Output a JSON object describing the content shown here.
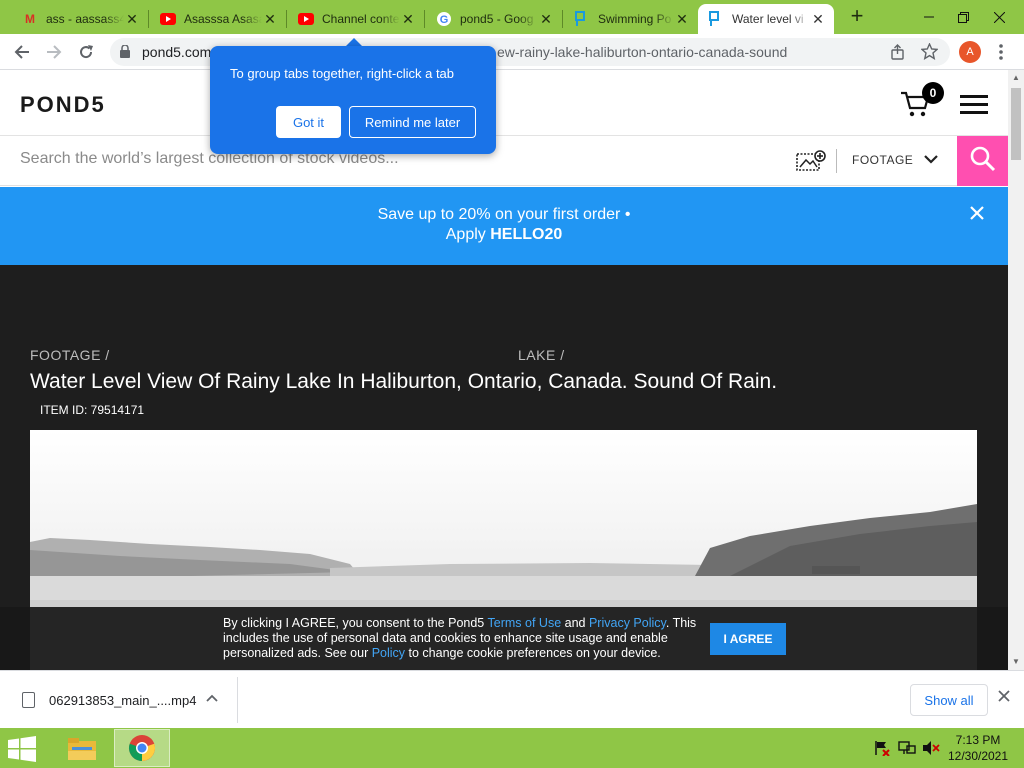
{
  "browser": {
    "tabs": [
      {
        "title": "ass - aassass4",
        "icon": "gmail-icon",
        "icon_color": "#d93025"
      },
      {
        "title": "Asasssa Asasa",
        "icon": "youtube-icon",
        "icon_color": "#ff0000"
      },
      {
        "title": "Channel conte",
        "icon": "youtube-icon",
        "icon_color": "#ff0000"
      },
      {
        "title": "pond5 - Goog",
        "icon": "google-icon",
        "icon_color": "#4285f4"
      },
      {
        "title": "Swimming Po",
        "icon": "pond5-icon",
        "icon_color": "#1a9ae0"
      },
      {
        "title": "Water level vi",
        "icon": "pond5-icon",
        "icon_color": "#1a9ae0"
      }
    ],
    "new_tab_label": "+",
    "url_host": "pond5.com",
    "url_rest": "ew-rainy-lake-haliburton-ontario-canada-sound",
    "profile_initial": "A"
  },
  "popup": {
    "text": "To group tabs together, right-click a tab",
    "got_it": "Got it",
    "remind": "Remind me later"
  },
  "site": {
    "logo": "POND5",
    "cart_count": "0",
    "search_placeholder": "Search the world’s largest collection of stock videos...",
    "filter_label": "FOOTAGE",
    "accent_color": "#ff4fb0"
  },
  "promo": {
    "line1": "Save up to 20% on your first order •",
    "line2_prefix": "Apply ",
    "code": "HELLO20",
    "bg_color": "#2196f3"
  },
  "item": {
    "breadcrumbs": [
      "FOOTAGE /",
      "LAKE /"
    ],
    "title": "Water Level View Of Rainy Lake In Haliburton, Ontario, Canada. Sound Of Rain.",
    "item_id": "ITEM ID: 79514171"
  },
  "cookie": {
    "t1": "By clicking I AGREE, you consent to the Pond5 ",
    "terms": "Terms of Use",
    "t2": " and ",
    "privacy": "Privacy Policy",
    "t3": ". This includes the use of personal data and cookies to enhance site usage and enable personalized ads. See our ",
    "policy": "Policy",
    "t4": " to change cookie preferences on your device.",
    "agree": "I AGREE"
  },
  "downloads": {
    "file": "062913853_main_....mp4",
    "show_all": "Show all"
  },
  "taskbar": {
    "time": "7:13 PM",
    "date": "12/30/2021"
  }
}
